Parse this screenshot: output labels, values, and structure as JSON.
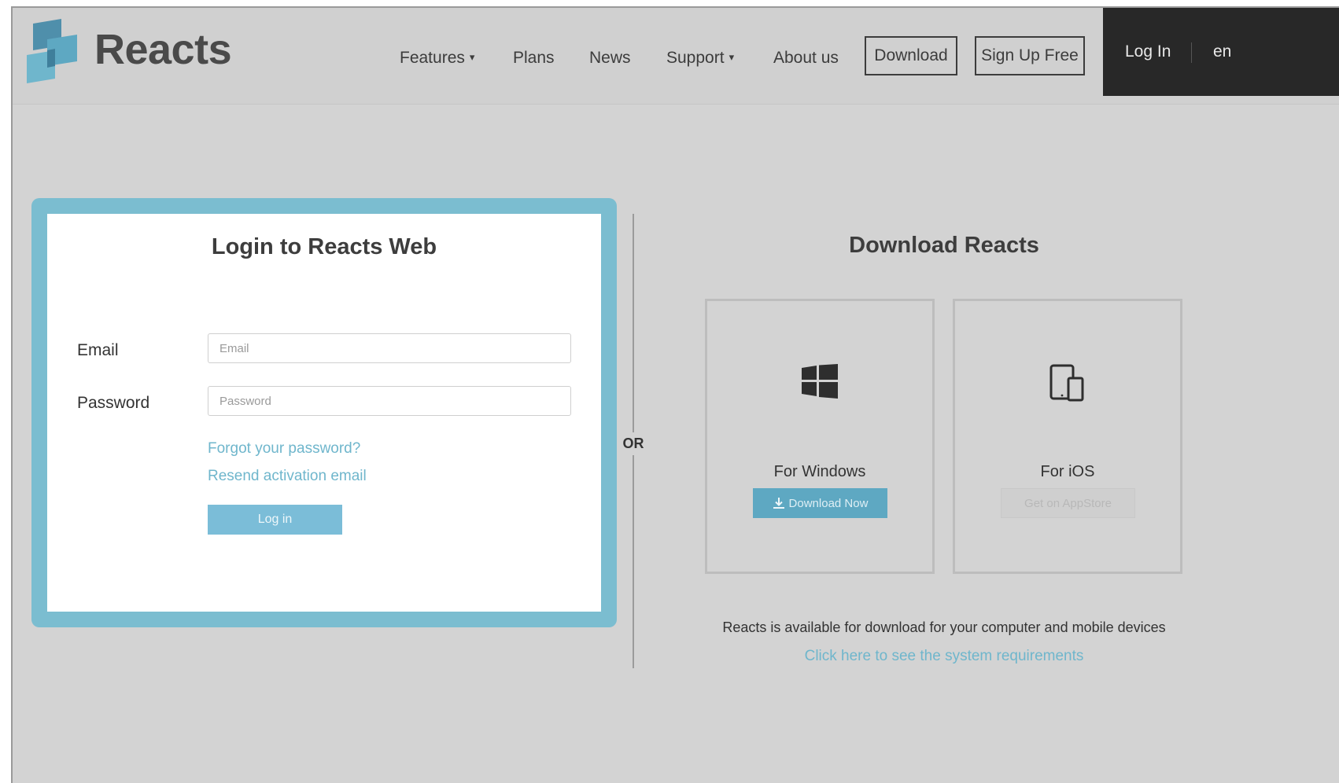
{
  "header": {
    "brand": "Reacts",
    "nav": [
      {
        "label": "Features",
        "dropdown": true
      },
      {
        "label": "Plans",
        "dropdown": false
      },
      {
        "label": "News",
        "dropdown": false
      },
      {
        "label": "Support",
        "dropdown": true
      },
      {
        "label": "About us",
        "dropdown": false
      }
    ],
    "download_label": "Download",
    "signup_label": "Sign Up Free",
    "login_label": "Log In",
    "language": "en",
    "caret": "▾"
  },
  "login": {
    "title": "Login to Reacts Web",
    "email_label": "Email",
    "email_placeholder": "Email",
    "email_value": "",
    "password_label": "Password",
    "password_placeholder": "Password",
    "password_value": "",
    "forgot_link": "Forgot your password?",
    "resend_link": "Resend activation email",
    "submit_label": "Log in"
  },
  "separator": "OR",
  "download": {
    "title": "Download Reacts",
    "platforms": [
      {
        "name": "For Windows",
        "button": "Download Now",
        "icon": "windows-icon"
      },
      {
        "name": "For iOS",
        "button": "Get on AppStore",
        "icon": "devices-icon"
      }
    ],
    "availability_text": "Reacts is available for download for your computer and mobile devices",
    "requirements_link": "Click here to see the system requirements"
  },
  "colors": {
    "accent": "#7bbdd0",
    "link": "#6fb6cc",
    "background": "#d3d3d3",
    "dark_bar": "#282828"
  }
}
